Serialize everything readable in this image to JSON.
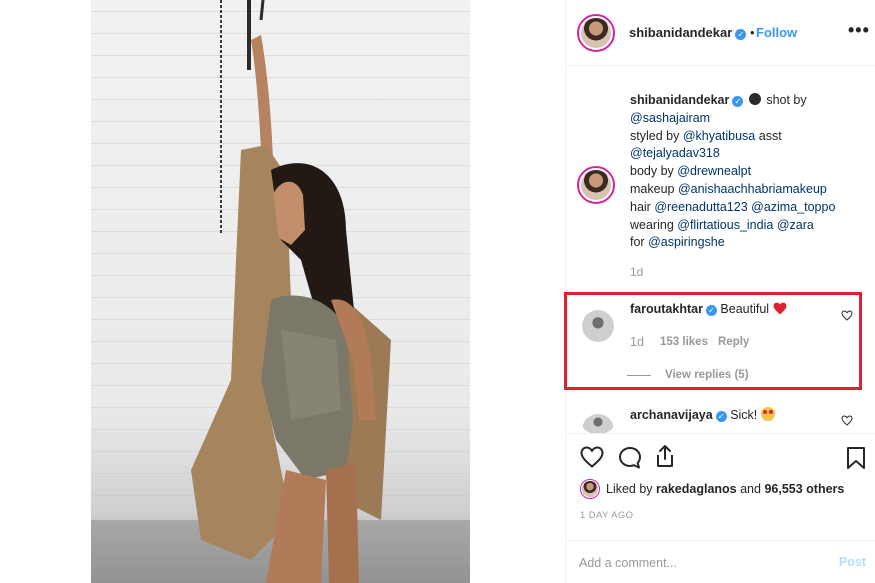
{
  "post": {
    "author": "shibanidandekar",
    "follow_label": "Follow",
    "more_label": "•••"
  },
  "caption": {
    "username": "shibanidandekar",
    "shot_by_prefix": "shot by",
    "line2": "@sashajairam",
    "line3_prefix": "styled by ",
    "line3_mention": "@khyatibusa",
    "line3_suffix": " asst",
    "line4": "@tejalyadav318",
    "line5_prefix": "body by ",
    "line5_mention": "@drewnealpt",
    "line6_prefix": "makeup ",
    "line6_mention": "@anishaachhabriamakeup",
    "line7_prefix": "hair ",
    "line7_mention1": "@reenadutta123",
    "line7_mention2": "@azima_toppo",
    "line8_prefix": "wearing ",
    "line8_mention1": "@flirtatious_india",
    "line8_mention2": "@zara",
    "line9_prefix": "for ",
    "line9_mention": "@aspiringshe",
    "time": "1d"
  },
  "comments": [
    {
      "username": "faroutakhtar",
      "text": "Beautiful",
      "time": "1d",
      "likes": "153 likes",
      "reply_label": "Reply",
      "view_replies": "View replies (5)"
    },
    {
      "username": "archanavijaya",
      "text": "Sick!"
    }
  ],
  "actions": {
    "liked_by_prefix": "Liked by ",
    "liked_by_user": "rakedaglanos",
    "liked_by_and": " and ",
    "liked_by_count": "96,553 others",
    "date": "1 DAY AGO",
    "comment_placeholder": "Add a comment...",
    "post_label": "Post"
  },
  "colors": {
    "accent": "#3897f0",
    "highlight_box": "#e0202e",
    "heart": "#ed4956"
  }
}
